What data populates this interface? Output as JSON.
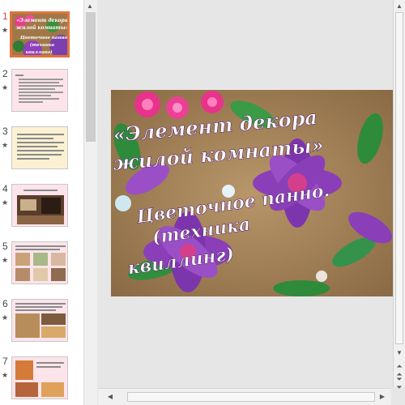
{
  "thumbnails": [
    {
      "number": "1",
      "star": "★",
      "active": true
    },
    {
      "number": "2",
      "star": "★",
      "active": false
    },
    {
      "number": "3",
      "star": "★",
      "active": false
    },
    {
      "number": "4",
      "star": "★",
      "active": false
    },
    {
      "number": "5",
      "star": "★",
      "active": false
    },
    {
      "number": "6",
      "star": "★",
      "active": false
    },
    {
      "number": "7",
      "star": "★",
      "active": false
    }
  ],
  "slide": {
    "title_line1": "«Элемент декора",
    "title_line2": "жилой комнаты»",
    "subtitle_line1": "Цветочное панно.",
    "subtitle_line2": "(техника",
    "subtitle_line3": "квиллинг)"
  },
  "thumb1": {
    "line1": "«Элемент декора",
    "line2": "жилой комнаты»",
    "line3": "Цветочное панно.",
    "line4": "(техника",
    "line5": "квиллинг)"
  },
  "scroll_icons": {
    "up": "arrow-up-icon",
    "down": "arrow-down-icon",
    "left": "arrow-left-icon",
    "right": "arrow-right-icon",
    "prev_slide": "double-arrow-up-icon",
    "next_slide": "double-arrow-down-icon"
  },
  "colors": {
    "active_border": "#e0733d",
    "active_number": "#c0504d"
  }
}
